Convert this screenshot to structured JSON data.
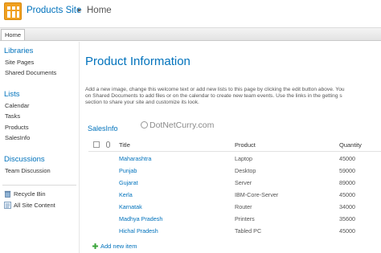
{
  "header": {
    "site_title": "Products Site",
    "separator": "▸",
    "current_page": "Home"
  },
  "topnav": {
    "tabs": [
      {
        "label": "Home"
      }
    ]
  },
  "sidebar": {
    "sections": [
      {
        "heading": "Libraries",
        "items": [
          "Site Pages",
          "Shared Documents"
        ]
      },
      {
        "heading": "Lists",
        "items": [
          "Calendar",
          "Tasks",
          "Products",
          "SalesInfo"
        ]
      },
      {
        "heading": "Discussions",
        "items": [
          "Team Discussion"
        ]
      }
    ],
    "footer": [
      {
        "label": "Recycle Bin",
        "icon": "recycle-bin-icon"
      },
      {
        "label": "All Site Content",
        "icon": "all-site-content-icon"
      }
    ]
  },
  "main": {
    "title": "Product Information",
    "description_lines": [
      "Add a new image, change this welcome text or add new lists to this page by clicking the edit button above. You",
      "on Shared Documents to add files or on the calendar to create new team events. Use the links in the getting s",
      "section to share your site and customize its look."
    ],
    "watermark": "DotNetCurry.com",
    "list": {
      "title": "SalesInfo",
      "columns": [
        "Title",
        "Product",
        "Quantity"
      ],
      "rows": [
        {
          "title": "Maharashtra",
          "product": "Laptop",
          "quantity": "45000"
        },
        {
          "title": "Punjab",
          "product": "Desktop",
          "quantity": "59000"
        },
        {
          "title": "Gujarat",
          "product": "Server",
          "quantity": "89000"
        },
        {
          "title": "Kerla",
          "product": "IBM-Core-Server",
          "quantity": "45000"
        },
        {
          "title": "Karnatak",
          "product": "Router",
          "quantity": "34000"
        },
        {
          "title": "Madhya Pradesh",
          "product": "Printers",
          "quantity": "35600"
        },
        {
          "title": "Hichal Pradesh",
          "product": "Tabled PC",
          "quantity": "45000"
        }
      ],
      "add_new_label": "Add new item"
    }
  },
  "colors": {
    "link_blue": "#0072bc",
    "logo_orange": "#f0a020"
  }
}
